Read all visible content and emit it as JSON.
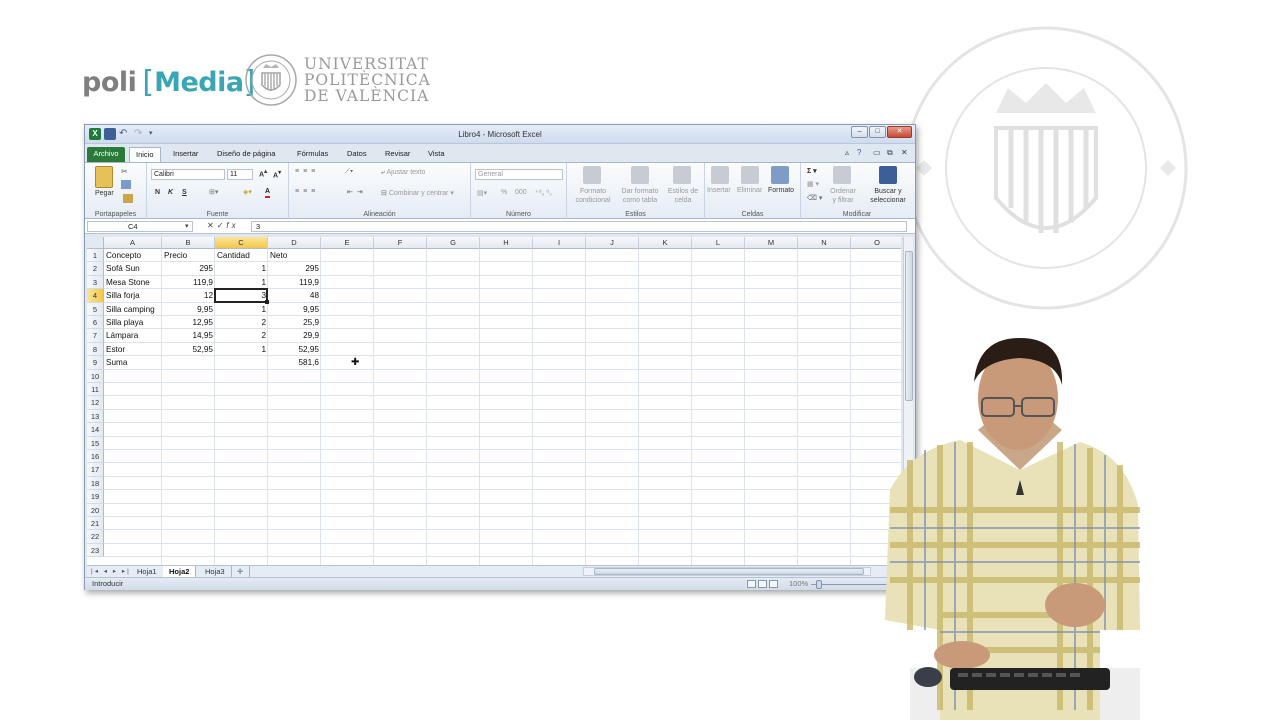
{
  "branding": {
    "poli": "poli",
    "media": "Media",
    "upv_lines": [
      "UNIVERSITAT",
      "POLITÈCNICA",
      "DE VALÈNCIA"
    ]
  },
  "window": {
    "title": "Libro4 - Microsoft Excel",
    "controls": {
      "minimize": "–",
      "maximize": "□",
      "close": "✕"
    }
  },
  "tabs": [
    "Archivo",
    "Inicio",
    "Insertar",
    "Diseño de página",
    "Fórmulas",
    "Datos",
    "Revisar",
    "Vista"
  ],
  "active_tab": "Inicio",
  "ribbon": {
    "portapapeles": {
      "label": "Portapapeles",
      "pegar": "Pegar"
    },
    "fuente": {
      "label": "Fuente",
      "font": "Calibri",
      "size": "11",
      "bold": "N",
      "italic": "K",
      "underline": "S"
    },
    "alineacion": {
      "label": "Alineación",
      "ajustar": "Ajustar texto",
      "combinar": "Combinar y centrar"
    },
    "numero": {
      "label": "Número",
      "format": "General"
    },
    "estilos": {
      "label": "Estilos",
      "formato_condicional": [
        "Formato",
        "condicional"
      ],
      "dar_formato": [
        "Dar formato",
        "como tabla"
      ],
      "estilos_celda": [
        "Estilos de",
        "celda"
      ]
    },
    "celdas": {
      "label": "Celdas",
      "insertar": "Insertar",
      "eliminar": "Eliminar",
      "formato": "Formato"
    },
    "modificar": {
      "label": "Modificar",
      "ordenar": [
        "Ordenar",
        "y filtrar"
      ],
      "buscar": [
        "Buscar y",
        "seleccionar"
      ]
    }
  },
  "formula_bar": {
    "name_box": "C4",
    "fx": "fx",
    "value": "3"
  },
  "columns": [
    "A",
    "B",
    "C",
    "D",
    "E",
    "F",
    "G",
    "H",
    "I",
    "J",
    "K",
    "L",
    "M",
    "N",
    "O"
  ],
  "rows": [
    "1",
    "2",
    "3",
    "4",
    "5",
    "6",
    "7",
    "8",
    "9",
    "10",
    "11",
    "12",
    "13",
    "14",
    "15",
    "16",
    "17",
    "18",
    "19",
    "20",
    "21",
    "22",
    "23"
  ],
  "table": {
    "headers": [
      "Concepto",
      "Precio",
      "Cantidad",
      "Neto"
    ],
    "data": [
      [
        "Sofá Sun",
        "295",
        "1",
        "295"
      ],
      [
        "Mesa Stone",
        "119,9",
        "1",
        "119,9"
      ],
      [
        "Silla forja",
        "12",
        "3",
        "48"
      ],
      [
        "Silla camping",
        "9,95",
        "1",
        "9,95"
      ],
      [
        "Silla playa",
        "12,95",
        "2",
        "25,9"
      ],
      [
        "Lámpara",
        "14,95",
        "2",
        "29,9"
      ],
      [
        "Estor",
        "52,95",
        "1",
        "52,95"
      ]
    ],
    "sum_label": "Suma",
    "sum_value": "581,6"
  },
  "sheet_tabs": [
    "Hoja1",
    "Hoja2",
    "Hoja3"
  ],
  "active_sheet": "Hoja2",
  "status": {
    "mode": "Introducir",
    "zoom": "100%"
  }
}
